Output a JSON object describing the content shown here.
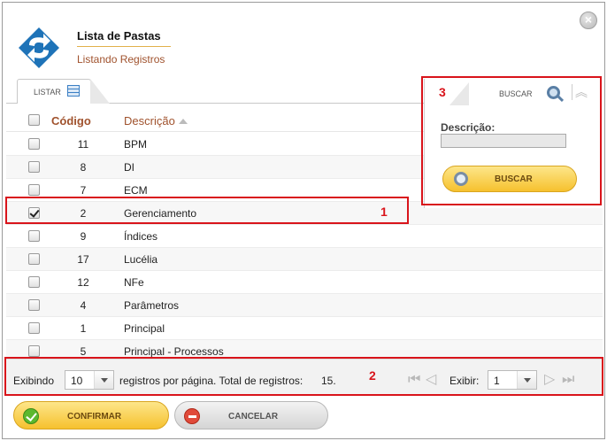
{
  "header": {
    "title": "Lista de Pastas",
    "subtitle": "Listando Registros",
    "close_icon": "close-icon"
  },
  "tabs": {
    "listar_label": "LISTAR",
    "buscar_label": "BUSCAR"
  },
  "table": {
    "columns": [
      "Código",
      "Descrição"
    ],
    "rows": [
      {
        "code": "11",
        "desc": "BPM",
        "checked": false
      },
      {
        "code": "8",
        "desc": "DI",
        "checked": false
      },
      {
        "code": "7",
        "desc": "ECM",
        "checked": false
      },
      {
        "code": "2",
        "desc": "Gerenciamento",
        "checked": true
      },
      {
        "code": "9",
        "desc": "Índices",
        "checked": false
      },
      {
        "code": "17",
        "desc": "Lucélia",
        "checked": false
      },
      {
        "code": "12",
        "desc": "NFe",
        "checked": false
      },
      {
        "code": "4",
        "desc": "Parâmetros",
        "checked": false
      },
      {
        "code": "1",
        "desc": "Principal",
        "checked": false
      },
      {
        "code": "5",
        "desc": "Principal - Processos",
        "checked": false
      }
    ]
  },
  "search": {
    "field_label": "Descrição:",
    "field_value": "",
    "button_label": "BUSCAR"
  },
  "footer": {
    "showing_label": "Exibindo",
    "per_page_value": "10",
    "per_page_text": "registros por página. Total de registros:",
    "total": "15.",
    "exibir_label": "Exibir:",
    "page_value": "1"
  },
  "buttons": {
    "confirm_label": "CONFIRMAR",
    "cancel_label": "CANCELAR"
  },
  "annotations": {
    "one": "1",
    "two": "2",
    "three": "3"
  },
  "colors": {
    "accent": "#f6c12e",
    "highlight": "#d9141b",
    "header_text": "#a0522d"
  }
}
